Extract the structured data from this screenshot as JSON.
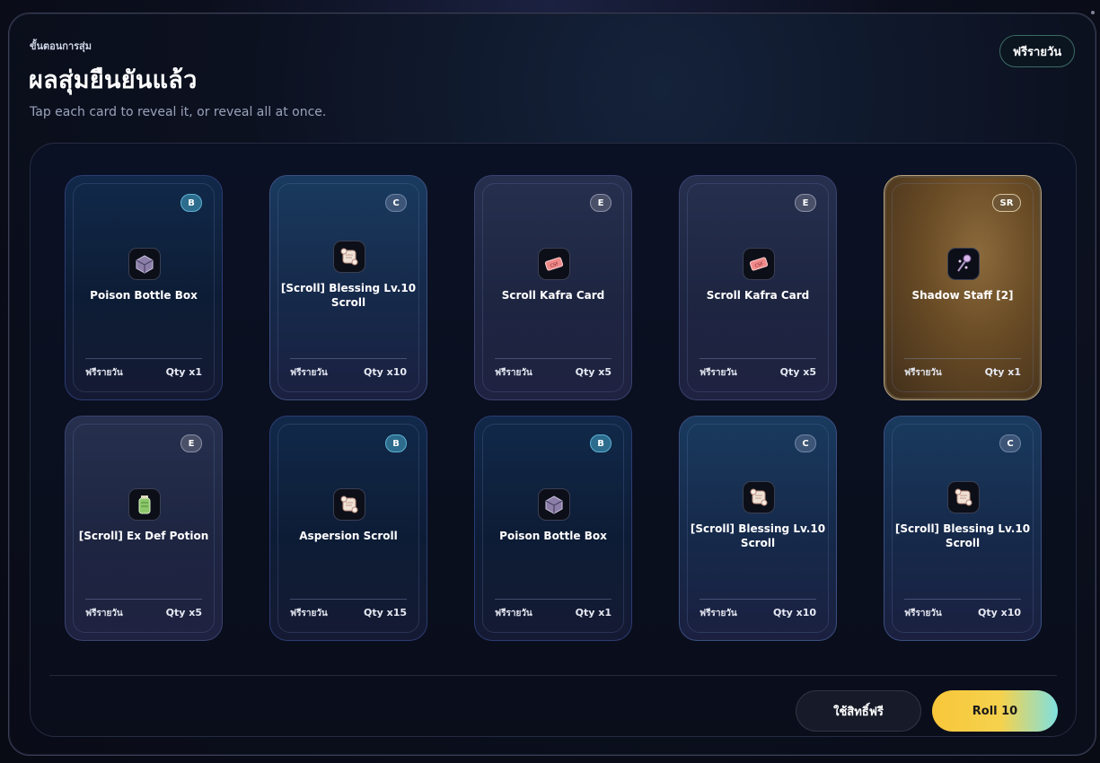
{
  "header": {
    "step_label": "ขั้นตอนการสุ่ม",
    "title": "ผลสุ่มยืนยันแล้ว",
    "subtitle": "Tap each card to reveal it, or reveal all at once.",
    "mode_pill": "ฟรีรายวัน"
  },
  "cards": [
    {
      "rarity": "B",
      "name_line1": "Poison Bottle Box",
      "name_line2": "",
      "source": "ฟรีรายวัน",
      "qty": "Qty x1",
      "icon": "box-icon"
    },
    {
      "rarity": "C",
      "name_line1": "[Scroll] Blessing Lv.10",
      "name_line2": "Scroll",
      "source": "ฟรีรายวัน",
      "qty": "Qty x10",
      "icon": "scroll-icon"
    },
    {
      "rarity": "E",
      "name_line1": "Scroll Kafra Card",
      "name_line2": "",
      "source": "ฟรีรายวัน",
      "qty": "Qty x5",
      "icon": "ticket-icon"
    },
    {
      "rarity": "E",
      "name_line1": "Scroll Kafra Card",
      "name_line2": "",
      "source": "ฟรีรายวัน",
      "qty": "Qty x5",
      "icon": "ticket-icon"
    },
    {
      "rarity": "SR",
      "name_line1": "Shadow Staff [2]",
      "name_line2": "",
      "source": "ฟรีรายวัน",
      "qty": "Qty x1",
      "icon": "staff-icon"
    },
    {
      "rarity": "E",
      "name_line1": "[Scroll] Ex Def Potion",
      "name_line2": "",
      "source": "ฟรีรายวัน",
      "qty": "Qty x5",
      "icon": "potion-icon"
    },
    {
      "rarity": "B",
      "name_line1": "Aspersion Scroll",
      "name_line2": "",
      "source": "ฟรีรายวัน",
      "qty": "Qty x15",
      "icon": "scroll-icon"
    },
    {
      "rarity": "B",
      "name_line1": "Poison Bottle Box",
      "name_line2": "",
      "source": "ฟรีรายวัน",
      "qty": "Qty x1",
      "icon": "box-icon"
    },
    {
      "rarity": "C",
      "name_line1": "[Scroll] Blessing Lv.10",
      "name_line2": "Scroll",
      "source": "ฟรีรายวัน",
      "qty": "Qty x10",
      "icon": "scroll-icon"
    },
    {
      "rarity": "C",
      "name_line1": "[Scroll] Blessing Lv.10",
      "name_line2": "Scroll",
      "source": "ฟรีรายวัน",
      "qty": "Qty x10",
      "icon": "scroll-icon"
    }
  ],
  "actions": {
    "use_free_label": "ใช้สิทธิ์ฟรี",
    "roll_label": "Roll 10"
  },
  "colors": {
    "accent_gold": "#f8c63a",
    "accent_cyan": "#7fe0e0",
    "panel_bg": "#0c1120"
  }
}
